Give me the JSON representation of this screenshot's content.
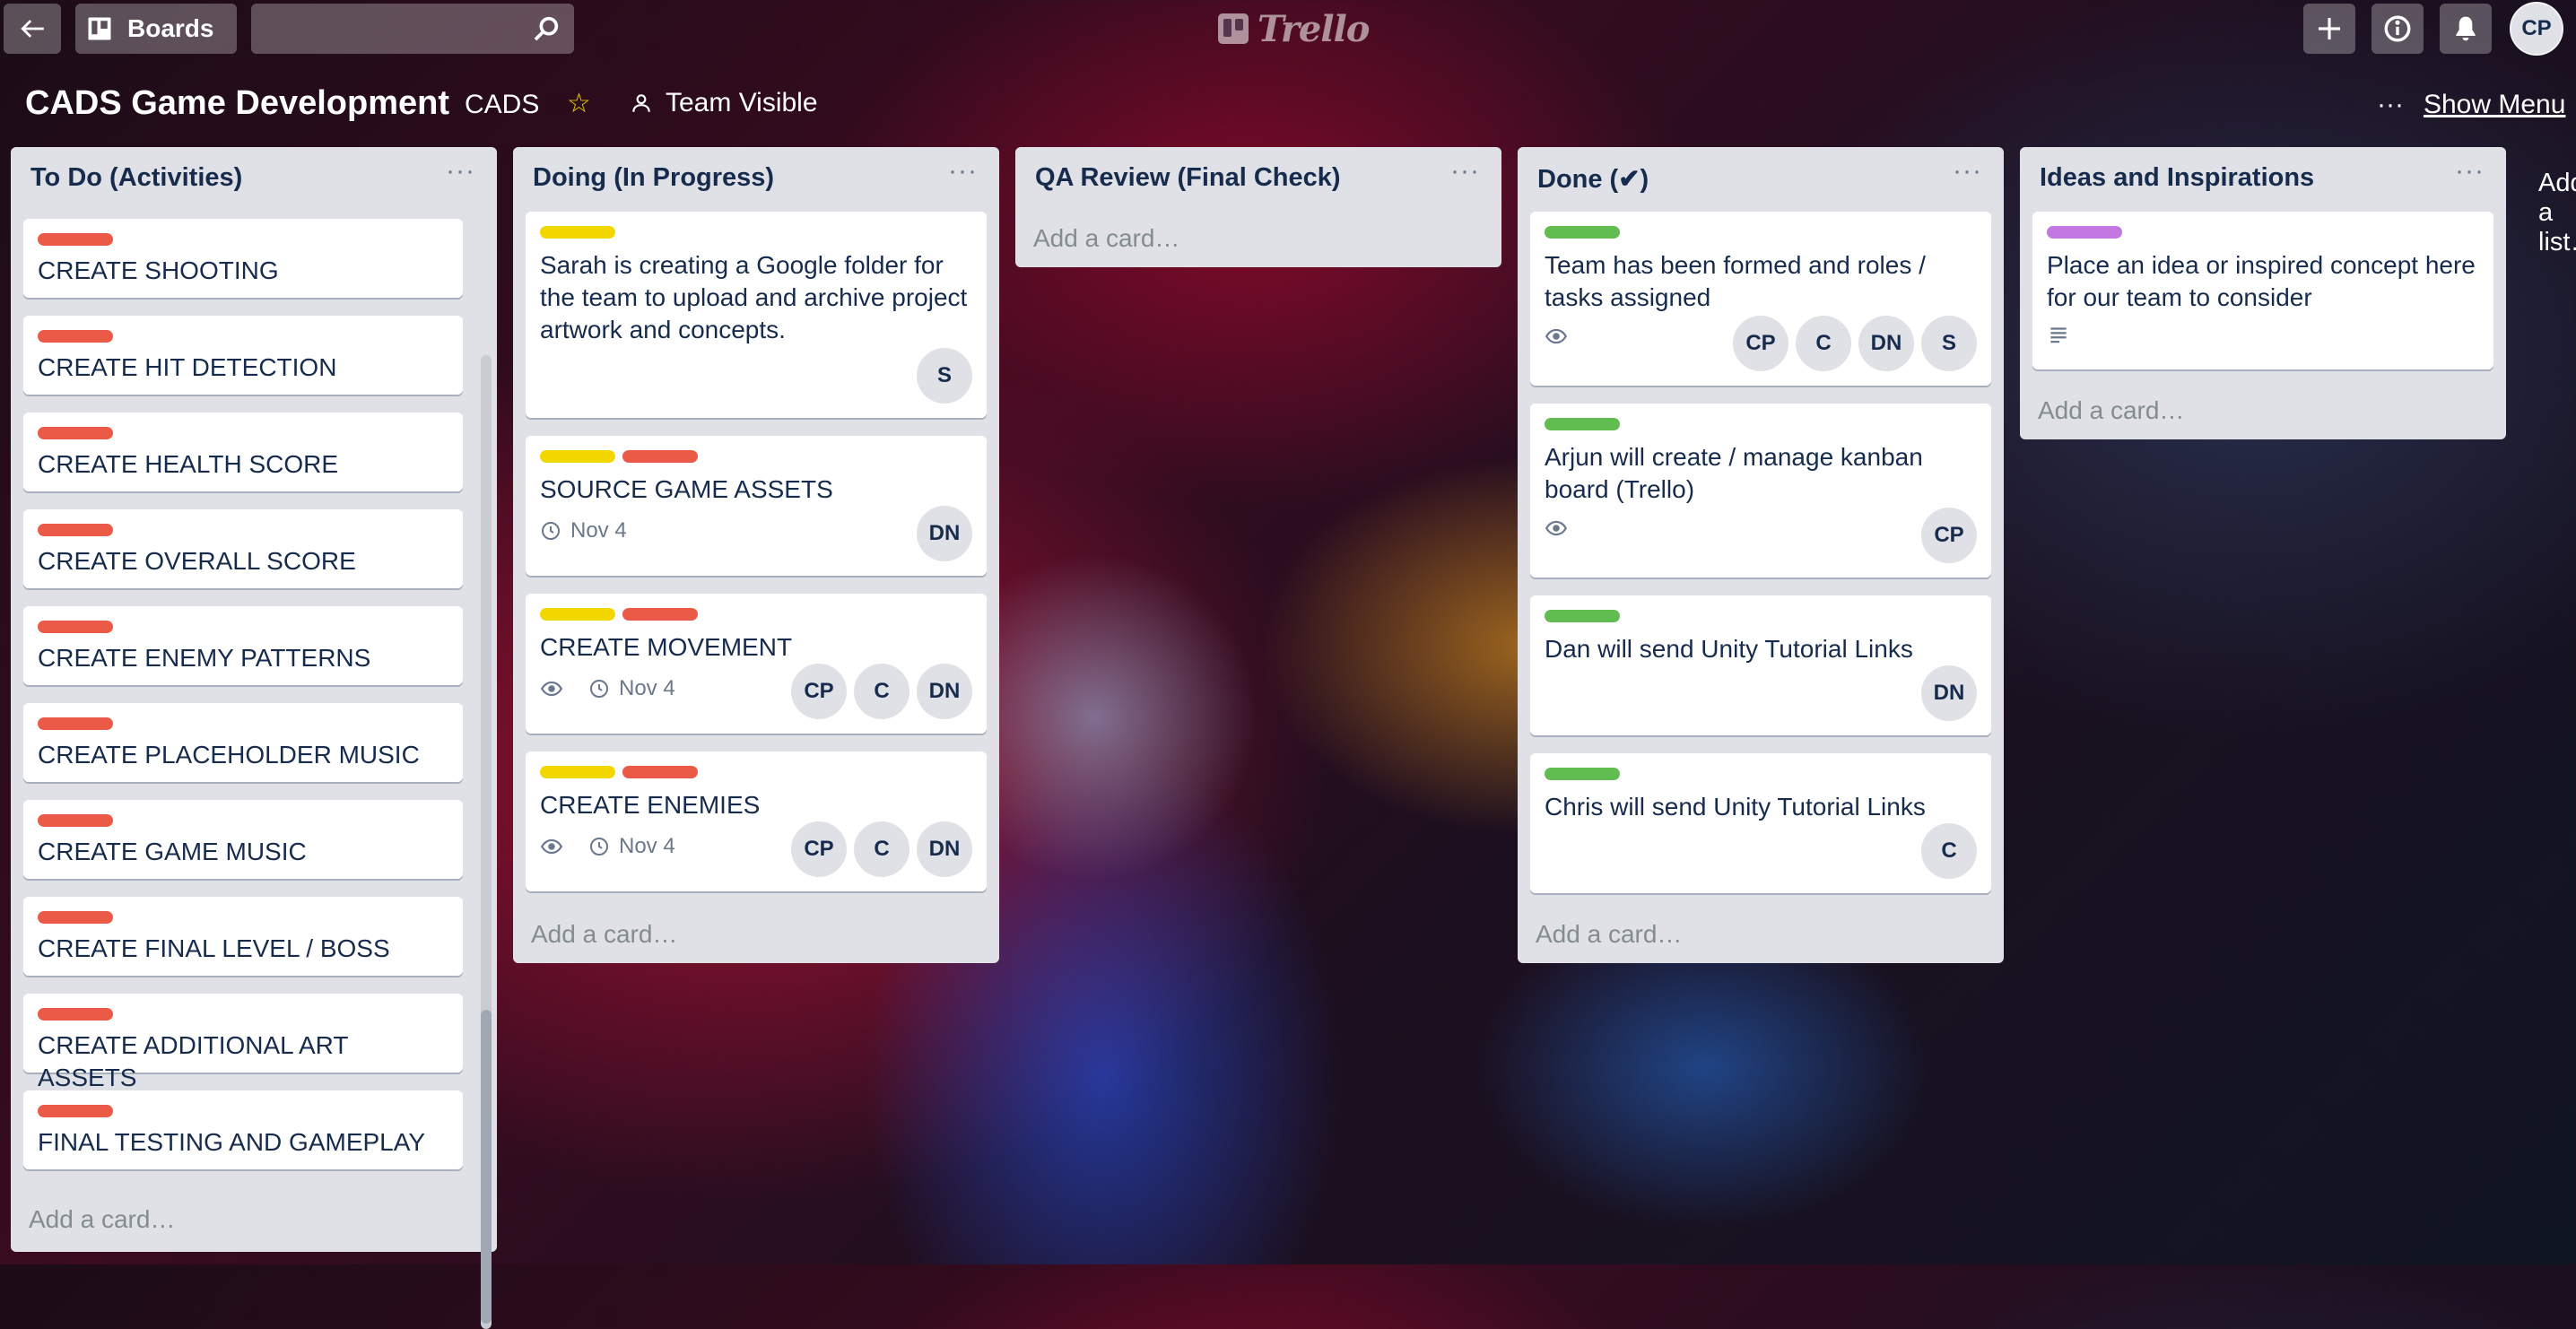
{
  "nav": {
    "boards_label": "Boards",
    "search_placeholder": "",
    "logo_text": "Trello",
    "user_initials": "CP"
  },
  "board": {
    "title": "CADS Game Development",
    "team": "CADS",
    "visibility": "Team Visible",
    "show_menu": "Show Menu",
    "add_list": "Add a list…"
  },
  "colors": {
    "green": "#61bd4f",
    "yellow": "#f2d600",
    "red": "#eb5a46",
    "purple": "#c377e0"
  },
  "lists": [
    {
      "title": "To Do (Activities)",
      "add_card": "Add a card…",
      "cards": [
        {
          "title": "CREATE SHOOTING"
        },
        {
          "title": "CREATE HIT DETECTION"
        },
        {
          "title": "CREATE HEALTH SCORE"
        },
        {
          "title": "CREATE OVERALL SCORE"
        },
        {
          "title": "CREATE ENEMY PATTERNS"
        },
        {
          "title": "CREATE PLACEHOLDER MUSIC"
        },
        {
          "title": "CREATE GAME MUSIC"
        },
        {
          "title": "CREATE FINAL LEVEL / BOSS"
        },
        {
          "title": "CREATE ADDITIONAL ART ASSETS"
        },
        {
          "title": "FINAL TESTING AND GAMEPLAY"
        }
      ]
    },
    {
      "title": "Doing (In Progress)",
      "add_card": "Add a card…",
      "cards": [
        {
          "title": "Sarah is creating a Google folder for the team to upload and archive project artwork and concepts.",
          "members": [
            "S"
          ]
        },
        {
          "title": "SOURCE GAME ASSETS",
          "due": "Nov 4",
          "members": [
            "DN"
          ]
        },
        {
          "title": "CREATE MOVEMENT",
          "due": "Nov 4",
          "members": [
            "CP",
            "C",
            "DN"
          ]
        },
        {
          "title": "CREATE ENEMIES",
          "due": "Nov 4",
          "members": [
            "CP",
            "C",
            "DN"
          ]
        }
      ]
    },
    {
      "title": "QA Review (Final Check)",
      "add_card": "Add a card…",
      "cards": []
    },
    {
      "title": "Done (✔)",
      "add_card": "Add a card…",
      "cards": [
        {
          "title": "Team has been formed and roles / tasks assigned",
          "members": [
            "CP",
            "C",
            "DN",
            "S"
          ]
        },
        {
          "title": "Arjun will create / manage kanban board (Trello)",
          "members": [
            "CP"
          ]
        },
        {
          "title": "Dan will send Unity Tutorial Links",
          "members": [
            "DN"
          ]
        },
        {
          "title": "Chris will send Unity Tutorial Links",
          "members": [
            "C"
          ]
        }
      ]
    },
    {
      "title": "Ideas and Inspirations",
      "add_card": "Add a card…",
      "cards": [
        {
          "title": "Place an idea or inspired concept here for our team to consider"
        }
      ]
    }
  ]
}
